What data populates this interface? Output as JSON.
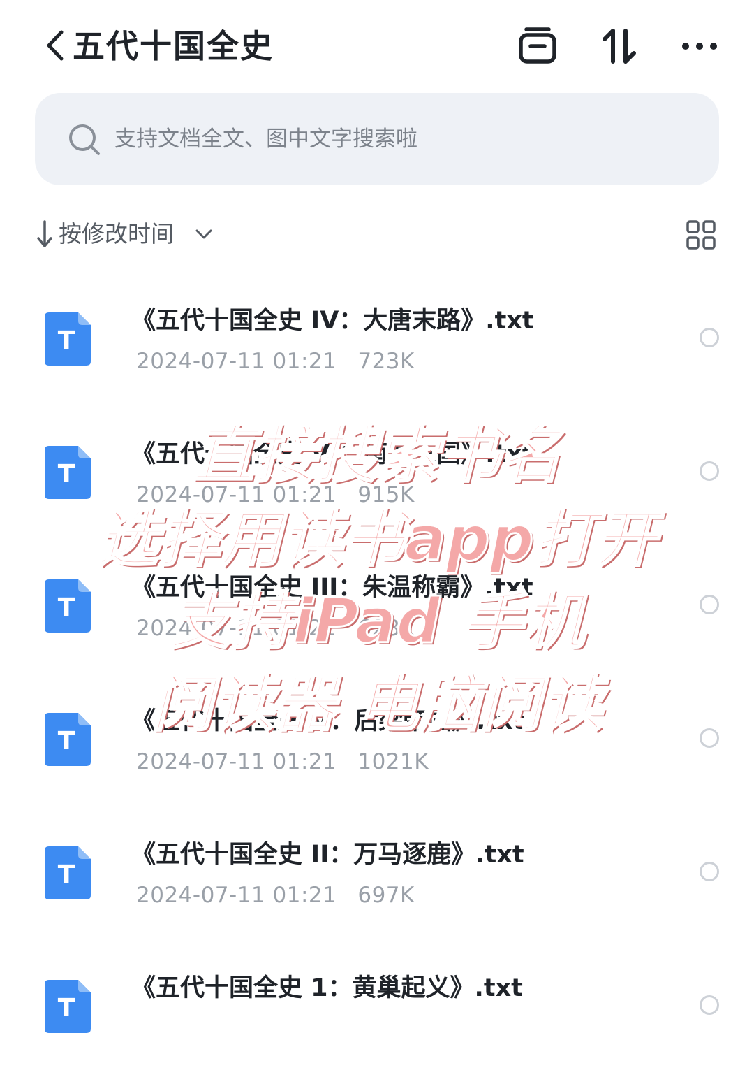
{
  "header": {
    "title": "五代十国全史",
    "icons": [
      "back-chevron-icon",
      "clipboard-icon",
      "sort-arrows-icon",
      "more-icon"
    ]
  },
  "search": {
    "placeholder": "支持文档全文、图中文字搜索啦"
  },
  "sort": {
    "label": "按修改时间"
  },
  "files": [
    {
      "name": "《五代十国全史 IV：大唐末路》.txt",
      "date": "2024-07-11 01:21",
      "size": "723K",
      "icon_letter": "T"
    },
    {
      "name": "《五代十国全史 VI：南方三国》.txt",
      "date": "2024-07-11 01:21",
      "size": "915K",
      "icon_letter": "T"
    },
    {
      "name": "《五代十国全史 III：朱温称霸》.txt",
      "date": "2024-07-11 01:21",
      "size": "628K",
      "icon_letter": "T"
    },
    {
      "name": "《五代十国全史 V：后梁帝国》.txt",
      "date": "2024-07-11 01:21",
      "size": "1021K",
      "icon_letter": "T"
    },
    {
      "name": "《五代十国全史 II：万马逐鹿》.txt",
      "date": "2024-07-11 01:21",
      "size": "697K",
      "icon_letter": "T"
    },
    {
      "name": "《五代十国全史 1：黄巢起义》.txt",
      "date": "",
      "size": "",
      "icon_letter": "T"
    }
  ],
  "overlay": {
    "line1": "直接搜索书名",
    "line2": "选择用读书app打开",
    "line3": "支持iPad 手机",
    "line4": "阅读器 电脑阅读"
  },
  "colors": {
    "file_icon": "#3d8bf2",
    "search_bg": "#eef1f6",
    "overlay_text": "#f4a8a8"
  }
}
